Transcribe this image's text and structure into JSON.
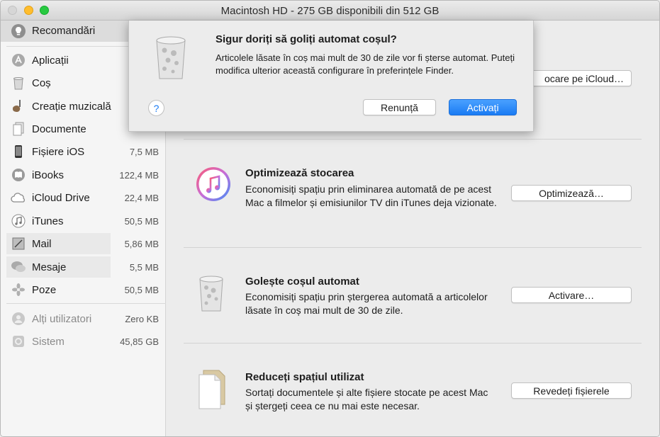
{
  "window": {
    "title": "Macintosh HD - 275 GB disponibili din 512 GB"
  },
  "sidebar": {
    "recommendations_label": "Recomandări",
    "items": [
      {
        "label": "Aplicații",
        "size": "",
        "icon": "app-store-icon"
      },
      {
        "label": "Coș",
        "size": "",
        "icon": "trash-icon"
      },
      {
        "label": "Creație muzicală",
        "size": "",
        "icon": "guitar-icon"
      },
      {
        "label": "Documente",
        "size": "",
        "icon": "document-icon"
      },
      {
        "label": "Fișiere iOS",
        "size": "7,5 MB",
        "icon": "iphone-icon"
      },
      {
        "label": "iBooks",
        "size": "122,4 MB",
        "icon": "ibooks-icon"
      },
      {
        "label": "iCloud Drive",
        "size": "22,4 MB",
        "icon": "cloud-icon"
      },
      {
        "label": "iTunes",
        "size": "50,5 MB",
        "icon": "music-note-icon"
      },
      {
        "label": "Mail",
        "size": "5,86 MB",
        "icon": "mail-stamp-icon"
      },
      {
        "label": "Mesaje",
        "size": "5,5 MB",
        "icon": "messages-icon"
      },
      {
        "label": "Poze",
        "size": "50,5 MB",
        "icon": "photos-icon"
      }
    ],
    "other_items": [
      {
        "label": "Alți utilizatori",
        "size": "Zero KB",
        "icon": "users-icon"
      },
      {
        "label": "Sistem",
        "size": "45,85 GB",
        "icon": "system-icon"
      }
    ]
  },
  "main": {
    "icloud_button": "ocare pe iCloud…",
    "recommendations": [
      {
        "title": "Optimizează stocarea",
        "desc": "Economisiți spațiu prin eliminarea automată de pe acest Mac a filmelor și emisiunilor TV din iTunes deja vizionate.",
        "button": "Optimizează…",
        "icon": "itunes-icon"
      },
      {
        "title": "Golește coșul automat",
        "desc": "Economisiți spațiu prin ștergerea automată a articolelor lăsate în coș mai mult de 30 de zile.",
        "button": "Activare…",
        "icon": "trash-icon"
      },
      {
        "title": "Reduceți spațiul utilizat",
        "desc": "Sortați documentele și alte fișiere stocate pe acest Mac și ștergeți ceea ce nu mai este necesar.",
        "button": "Revedeți fișierele",
        "icon": "documents-icon"
      }
    ]
  },
  "sheet": {
    "title": "Sigur doriți să goliți automat coșul?",
    "text": "Articolele lăsate în coș mai mult de 30 de zile vor fi șterse automat. Puteți modifica ulterior această configurare în preferințele Finder.",
    "help": "?",
    "cancel": "Renunță",
    "confirm": "Activați"
  }
}
